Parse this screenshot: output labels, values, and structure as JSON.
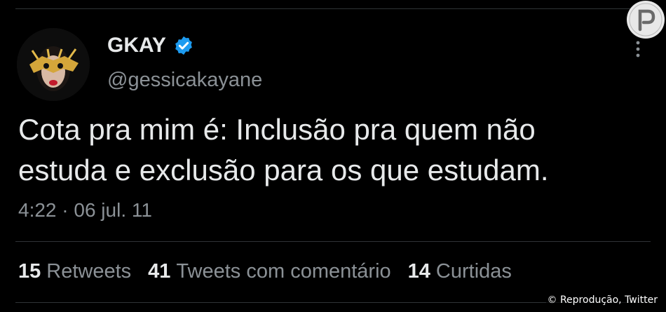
{
  "tweet": {
    "display_name": "GKAY",
    "handle": "@gessicakayane",
    "text_line1": "Cota pra mim é: Inclusão pra quem não",
    "text_line2": "estuda e exclusão para os que estudam.",
    "timestamp": "4:22 · 06 jul. 11",
    "stats": {
      "retweets_count": "15",
      "retweets_label": "Retweets",
      "quotes_count": "41",
      "quotes_label": "Tweets com comentário",
      "likes_count": "14",
      "likes_label": "Curtidas"
    }
  },
  "credit": "© Reprodução, Twitter",
  "icons": {
    "verified": "verified-badge-icon",
    "more": "more-options-icon",
    "watermark": "purepeople-logo-icon"
  },
  "colors": {
    "background": "#000000",
    "text": "#e7e9ea",
    "secondary": "#8b9196",
    "verified": "#1d9bf0",
    "divider": "#2f3336"
  }
}
